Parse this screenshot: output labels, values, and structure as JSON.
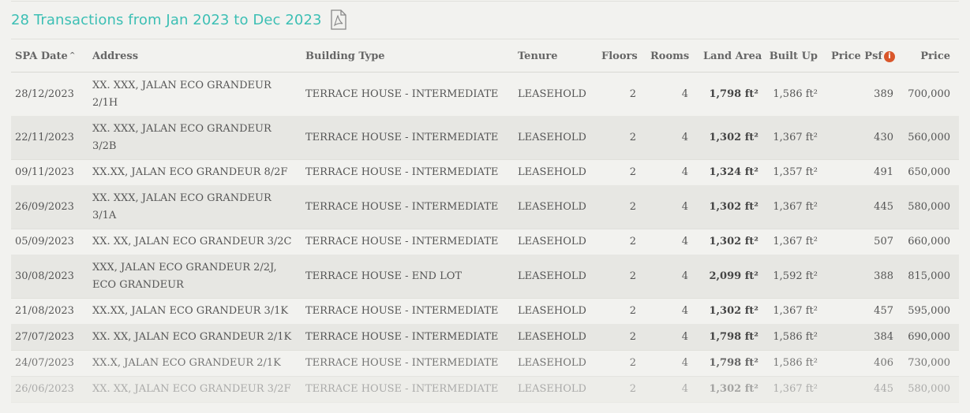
{
  "title": "28 Transactions from Jan 2023 to Dec 2023",
  "icons": {
    "export": "pdf-file-icon",
    "info": "info-icon",
    "sort": "sort-asc-icon"
  },
  "colors": {
    "accent": "#3cbfb4",
    "info": "#d9572b"
  },
  "headers": {
    "spa_date": "SPA Date",
    "address": "Address",
    "building_type": "Building Type",
    "tenure": "Tenure",
    "floors": "Floors",
    "rooms": "Rooms",
    "land_area": "Land Area",
    "built_up": "Built Up",
    "price_psf": "Price Psf",
    "price": "Price"
  },
  "sort_indicator": "^",
  "info_glyph": "i",
  "rows": [
    {
      "date": "28/12/2023",
      "addr1": "XX. XXX, JALAN ECO GRANDEUR",
      "addr2": "2/1H",
      "type": "TERRACE HOUSE - INTERMEDIATE",
      "tenure": "LEASEHOLD",
      "floors": "2",
      "rooms": "4",
      "land": "1,798 ft²",
      "built": "1,586 ft²",
      "psf": "389",
      "price": "700,000"
    },
    {
      "date": "22/11/2023",
      "addr1": "XX. XXX, JALAN ECO GRANDEUR",
      "addr2": "3/2B",
      "type": "TERRACE HOUSE - INTERMEDIATE",
      "tenure": "LEASEHOLD",
      "floors": "2",
      "rooms": "4",
      "land": "1,302 ft²",
      "built": "1,367 ft²",
      "psf": "430",
      "price": "560,000"
    },
    {
      "date": "09/11/2023",
      "addr1": "XX.XX, JALAN ECO GRANDEUR 8/2F",
      "addr2": "",
      "type": "TERRACE HOUSE - INTERMEDIATE",
      "tenure": "LEASEHOLD",
      "floors": "2",
      "rooms": "4",
      "land": "1,324 ft²",
      "built": "1,357 ft²",
      "psf": "491",
      "price": "650,000"
    },
    {
      "date": "26/09/2023",
      "addr1": "XX. XXX, JALAN ECO GRANDEUR",
      "addr2": "3/1A",
      "type": "TERRACE HOUSE - INTERMEDIATE",
      "tenure": "LEASEHOLD",
      "floors": "2",
      "rooms": "4",
      "land": "1,302 ft²",
      "built": "1,367 ft²",
      "psf": "445",
      "price": "580,000"
    },
    {
      "date": "05/09/2023",
      "addr1": "XX. XX, JALAN ECO GRANDEUR 3/2C",
      "addr2": "",
      "type": "TERRACE HOUSE - INTERMEDIATE",
      "tenure": "LEASEHOLD",
      "floors": "2",
      "rooms": "4",
      "land": "1,302 ft²",
      "built": "1,367 ft²",
      "psf": "507",
      "price": "660,000"
    },
    {
      "date": "30/08/2023",
      "addr1": "XXX, JALAN ECO GRANDEUR 2/2J,",
      "addr2": "ECO GRANDEUR",
      "type": "TERRACE HOUSE - END LOT",
      "tenure": "LEASEHOLD",
      "floors": "2",
      "rooms": "4",
      "land": "2,099 ft²",
      "built": "1,592 ft²",
      "psf": "388",
      "price": "815,000"
    },
    {
      "date": "21/08/2023",
      "addr1": "XX.XX, JALAN ECO GRANDEUR 3/1K",
      "addr2": "",
      "type": "TERRACE HOUSE - INTERMEDIATE",
      "tenure": "LEASEHOLD",
      "floors": "2",
      "rooms": "4",
      "land": "1,302 ft²",
      "built": "1,367 ft²",
      "psf": "457",
      "price": "595,000"
    },
    {
      "date": "27/07/2023",
      "addr1": "XX. XX, JALAN ECO GRANDEUR 2/1K",
      "addr2": "",
      "type": "TERRACE HOUSE - INTERMEDIATE",
      "tenure": "LEASEHOLD",
      "floors": "2",
      "rooms": "4",
      "land": "1,798 ft²",
      "built": "1,586 ft²",
      "psf": "384",
      "price": "690,000"
    },
    {
      "date": "24/07/2023",
      "addr1": "XX.X, JALAN ECO GRANDEUR 2/1K",
      "addr2": "",
      "type": "TERRACE HOUSE - INTERMEDIATE",
      "tenure": "LEASEHOLD",
      "floors": "2",
      "rooms": "4",
      "land": "1,798 ft²",
      "built": "1,586 ft²",
      "psf": "406",
      "price": "730,000"
    },
    {
      "date": "26/06/2023",
      "addr1": "XX. XX, JALAN ECO GRANDEUR 3/2F",
      "addr2": "",
      "type": "TERRACE HOUSE - INTERMEDIATE",
      "tenure": "LEASEHOLD",
      "floors": "2",
      "rooms": "4",
      "land": "1,302 ft²",
      "built": "1,367 ft²",
      "psf": "445",
      "price": "580,000"
    }
  ]
}
